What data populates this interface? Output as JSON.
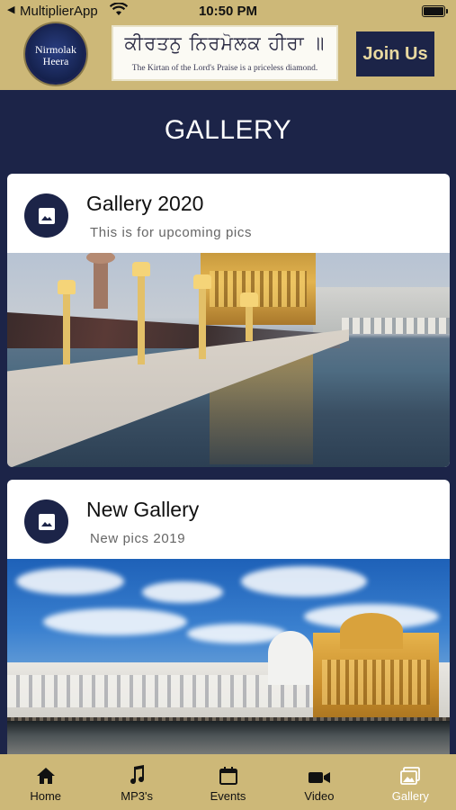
{
  "status_bar": {
    "back_glyph": "◀",
    "carrier": "MultiplierApp",
    "time": "10:50 PM",
    "battery_level": 1.0
  },
  "header": {
    "logo_line1": "Nirmolak",
    "logo_line2": "Heera",
    "banner_script": "ਕੀਰਤਨੁ ਨਿਰਮੋਲਕ ਹੀਰਾ ॥",
    "banner_tagline": "The Kirtan of the Lord's Praise is a priceless diamond.",
    "join_label": "Join Us"
  },
  "page": {
    "title": "GALLERY"
  },
  "galleries": [
    {
      "name": "Gallery 2020",
      "description": "This is for upcoming pics",
      "icon": "image-icon"
    },
    {
      "name": "New Gallery",
      "description": "New pics 2019",
      "icon": "image-icon"
    }
  ],
  "tabs": [
    {
      "label": "Home",
      "icon": "home-icon",
      "active": false
    },
    {
      "label": "MP3's",
      "icon": "music-icon",
      "active": false
    },
    {
      "label": "Events",
      "icon": "calendar-icon",
      "active": false
    },
    {
      "label": "Video",
      "icon": "video-camera-icon",
      "active": false
    },
    {
      "label": "Gallery",
      "icon": "gallery-icon",
      "active": true
    }
  ],
  "colors": {
    "gold": "#cdb878",
    "navy": "#1c2448",
    "join_text": "#e9d9a0",
    "active_tab_text": "#ffffff"
  }
}
